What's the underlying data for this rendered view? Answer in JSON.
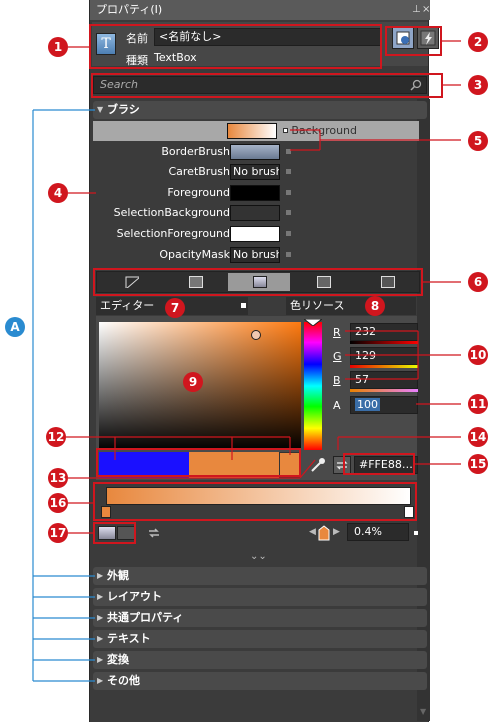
{
  "window": {
    "title": "プロパティ(I)",
    "pin_glyph": "⊥",
    "close_glyph": "×"
  },
  "header": {
    "name_label": "名前",
    "name_value": "<名前なし>",
    "type_label": "種類",
    "type_value": "TextBox",
    "type_icon_glyph": "T"
  },
  "search": {
    "placeholder": "Search"
  },
  "brush_section": {
    "title": "ブラシ",
    "items": [
      {
        "label": "Background",
        "swatch": "gradient",
        "text": ""
      },
      {
        "label": "BorderBrush",
        "swatch": "slate",
        "text": ""
      },
      {
        "label": "CaretBrush",
        "swatch": "none",
        "text": "No brush"
      },
      {
        "label": "Foreground",
        "swatch": "black",
        "text": ""
      },
      {
        "label": "SelectionBackground",
        "swatch": "dark",
        "text": ""
      },
      {
        "label": "SelectionForeground",
        "swatch": "white",
        "text": ""
      },
      {
        "label": "OpacityMask",
        "swatch": "none",
        "text": "No brush"
      }
    ]
  },
  "editor": {
    "editor_tab": "エディター",
    "resource_tab": "色リソース",
    "r_label": "R",
    "g_label": "G",
    "b_label": "B",
    "a_label": "A",
    "r": "232",
    "g": "129",
    "b": "57",
    "a": "100",
    "hex": "#FFE88…",
    "offset": "0.4%",
    "expand_glyph": "⌄⌄"
  },
  "sections": [
    "外観",
    "レイアウト",
    "共通プロパティ",
    "テキスト",
    "変換",
    "その他"
  ],
  "annotations": {
    "n1": "1",
    "n2": "2",
    "n3": "3",
    "n4": "4",
    "n5": "5",
    "n6": "6",
    "n7": "7",
    "n8": "8",
    "n9": "9",
    "n10": "10",
    "n11": "11",
    "n12": "12",
    "n13": "13",
    "n14": "14",
    "n15": "15",
    "n16": "16",
    "n17": "17",
    "nA": "A"
  },
  "colors": {
    "panel": "#3b3b3b",
    "annotation_red": "#d0161e",
    "annotation_blue": "#2a8bd0",
    "gradient_start": "#e8883e",
    "gradient_end": "#ffffff"
  }
}
